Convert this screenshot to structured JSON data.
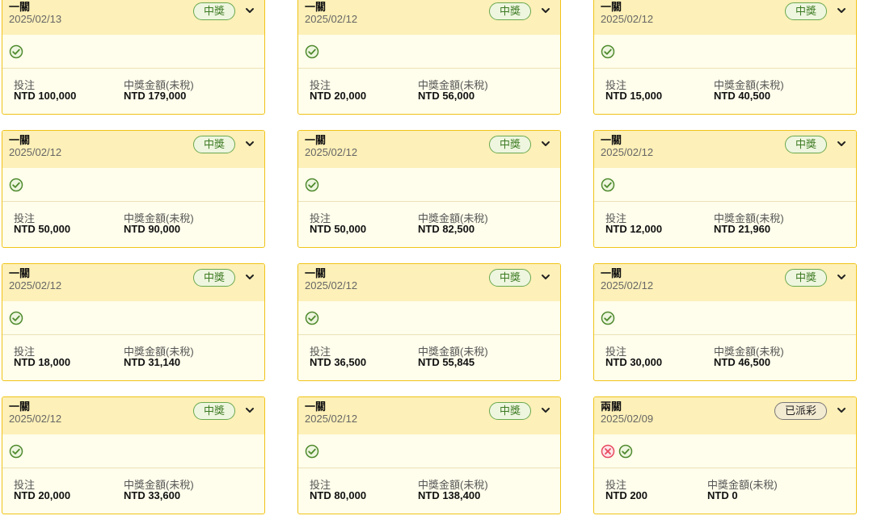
{
  "labels": {
    "stake_label": "投注",
    "payout_label": "中獎金額(未稅)"
  },
  "colors": {
    "card_border": "#f0c419",
    "header_bg": "#fdf0b8",
    "body_bg": "#fffdeb",
    "won_green": "#6aa84f",
    "lost_red": "#e84a5f"
  },
  "bets": [
    {
      "type": "一關",
      "date": "2025/02/13",
      "status": "中獎",
      "status_kind": "won",
      "results": [
        "check"
      ],
      "stake": "NTD 100,000",
      "payout": "NTD 179,000"
    },
    {
      "type": "一關",
      "date": "2025/02/12",
      "status": "中獎",
      "status_kind": "won",
      "results": [
        "check"
      ],
      "stake": "NTD 20,000",
      "payout": "NTD 56,000"
    },
    {
      "type": "一關",
      "date": "2025/02/12",
      "status": "中獎",
      "status_kind": "won",
      "results": [
        "check"
      ],
      "stake": "NTD 15,000",
      "payout": "NTD 40,500"
    },
    {
      "type": "一關",
      "date": "2025/02/12",
      "status": "中獎",
      "status_kind": "won",
      "results": [
        "check"
      ],
      "stake": "NTD 50,000",
      "payout": "NTD 90,000"
    },
    {
      "type": "一關",
      "date": "2025/02/12",
      "status": "中獎",
      "status_kind": "won",
      "results": [
        "check"
      ],
      "stake": "NTD 50,000",
      "payout": "NTD 82,500"
    },
    {
      "type": "一關",
      "date": "2025/02/12",
      "status": "中獎",
      "status_kind": "won",
      "results": [
        "check"
      ],
      "stake": "NTD 12,000",
      "payout": "NTD 21,960"
    },
    {
      "type": "一關",
      "date": "2025/02/12",
      "status": "中獎",
      "status_kind": "won",
      "results": [
        "check"
      ],
      "stake": "NTD 18,000",
      "payout": "NTD 31,140"
    },
    {
      "type": "一關",
      "date": "2025/02/12",
      "status": "中獎",
      "status_kind": "won",
      "results": [
        "check"
      ],
      "stake": "NTD 36,500",
      "payout": "NTD 55,845"
    },
    {
      "type": "一關",
      "date": "2025/02/12",
      "status": "中獎",
      "status_kind": "won",
      "results": [
        "check"
      ],
      "stake": "NTD 30,000",
      "payout": "NTD 46,500"
    },
    {
      "type": "一關",
      "date": "2025/02/12",
      "status": "中獎",
      "status_kind": "won",
      "results": [
        "check"
      ],
      "stake": "NTD 20,000",
      "payout": "NTD 33,600"
    },
    {
      "type": "一關",
      "date": "2025/02/12",
      "status": "中獎",
      "status_kind": "won",
      "results": [
        "check"
      ],
      "stake": "NTD 80,000",
      "payout": "NTD 138,400"
    },
    {
      "type": "兩關",
      "date": "2025/02/09",
      "status": "已派彩",
      "status_kind": "paid",
      "results": [
        "cross",
        "check"
      ],
      "stake": "NTD 200",
      "payout": "NTD 0"
    }
  ]
}
